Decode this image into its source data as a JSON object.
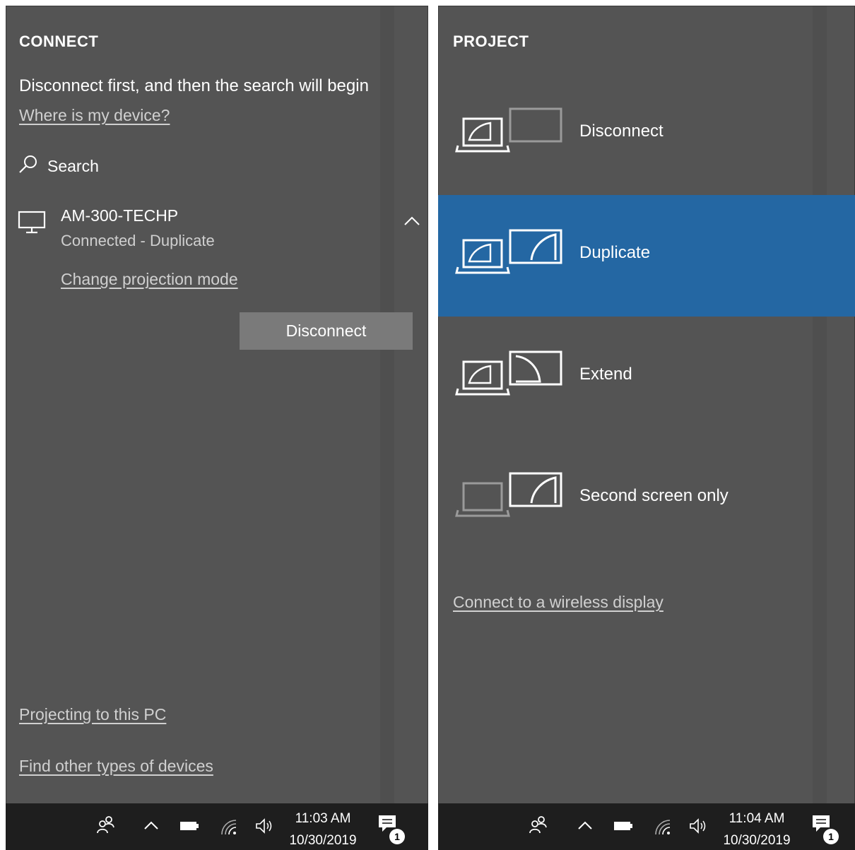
{
  "connect": {
    "heading": "CONNECT",
    "status": "Disconnect first, and then the search will begin",
    "where_link": "Where is my device?",
    "search_label": "Search",
    "device": {
      "name": "AM-300-TECHP",
      "status": "Connected - Duplicate",
      "change_mode_link": "Change projection mode",
      "disconnect_button": "Disconnect"
    },
    "projecting_link": "Projecting to this PC",
    "find_link": "Find other types of devices",
    "taskbar": {
      "time": "11:03 AM",
      "date": "10/30/2019",
      "notification_count": "1"
    }
  },
  "project": {
    "heading": "PROJECT",
    "modes": [
      {
        "label": "Disconnect",
        "selected": false
      },
      {
        "label": "Duplicate",
        "selected": true
      },
      {
        "label": "Extend",
        "selected": false
      },
      {
        "label": "Second screen only",
        "selected": false
      }
    ],
    "wireless_link": "Connect to a wireless display",
    "taskbar": {
      "time": "11:04 AM",
      "date": "10/30/2019",
      "notification_count": "1"
    }
  },
  "colors": {
    "panel_bg": "#545454",
    "selected_bg": "#2467a3",
    "button_bg": "#7a7a7a",
    "taskbar_bg": "#1e1e1e"
  },
  "icons": [
    "search-icon",
    "monitor-icon",
    "chevron-up-icon",
    "people-icon",
    "tray-up-icon",
    "battery-icon",
    "wifi-icon",
    "volume-icon",
    "action-center-icon",
    "laptop-icon",
    "display-icon"
  ]
}
